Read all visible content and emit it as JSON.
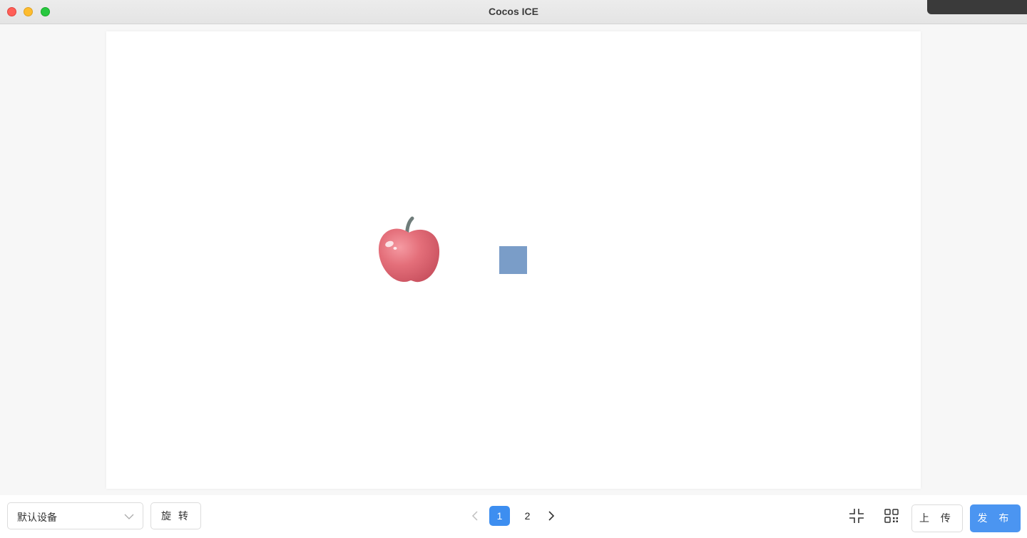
{
  "window": {
    "title": "Cocos ICE"
  },
  "titlebar": {
    "buttons": [
      "close",
      "minimize",
      "maximize"
    ]
  },
  "stage": {
    "sprites": [
      {
        "name": "apple-sprite",
        "icon": "apple-icon"
      },
      {
        "name": "blue-square-sprite",
        "color": "#7a9dc8"
      }
    ]
  },
  "toolbar": {
    "device_select": {
      "value": "默认设备"
    },
    "rotate_label": "旋 转",
    "pagination": {
      "pages": [
        "1",
        "2"
      ],
      "current": "1"
    },
    "upload_label": "上 传",
    "publish_label": "发 布"
  },
  "colors": {
    "accent": "#3d8ef0",
    "publish": "#4b95f1"
  }
}
